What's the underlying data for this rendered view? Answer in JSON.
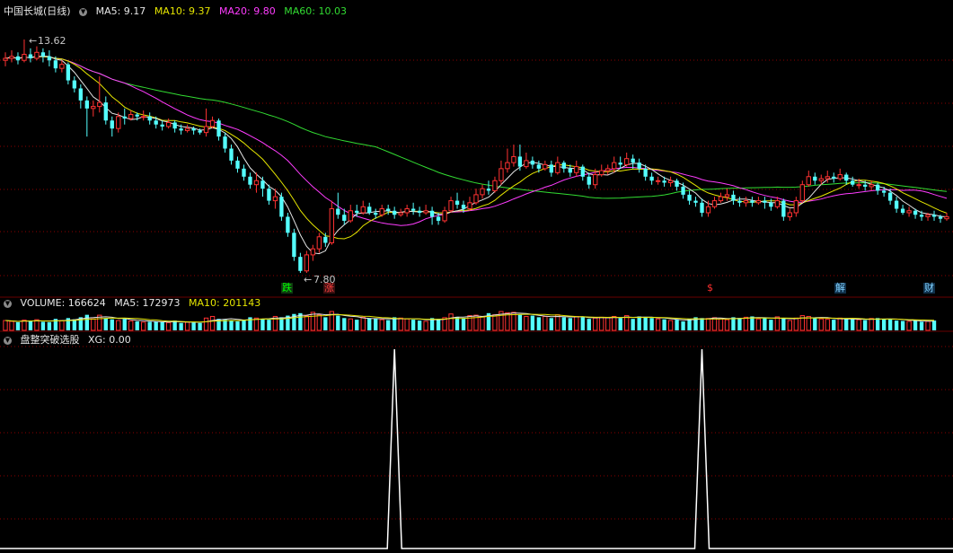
{
  "price_panel": {
    "title": "中国长城(日线)",
    "ma5": "MA5: 9.17",
    "ma10": "MA10: 9.37",
    "ma20": "MA20: 9.80",
    "ma60": "MA60: 10.03",
    "high_label": "13.62",
    "low_label": "7.80",
    "events": [
      {
        "label": "跌",
        "color": "#00ff00",
        "bg": "#103810"
      },
      {
        "label": "涨",
        "color": "#ff4040",
        "bg": "#3a1010"
      },
      {
        "label": "$",
        "color": "#ff3030",
        "bg": ""
      },
      {
        "label": "解",
        "color": "#7fd0ff",
        "bg": "#10304a"
      },
      {
        "label": "财",
        "color": "#7fd0ff",
        "bg": "#10304a"
      }
    ]
  },
  "volume_panel": {
    "volume": "VOLUME: 166624",
    "ma5": "MA5: 172973",
    "ma10": "MA10: 201143"
  },
  "indicator_panel": {
    "name": "盘整突破选股",
    "xg": "XG: 0.00"
  },
  "colors": {
    "up": "#ff3232",
    "down": "#54ffff",
    "ma5": "#e6e6e6",
    "ma10": "#e6e600",
    "ma20": "#ff3cff",
    "ma60": "#32dc32",
    "grid": "#8b0000"
  },
  "chart_data": {
    "type": "candlestick",
    "price_scale": [
      7.8,
      13.62
    ],
    "candles": [
      [
        13.1,
        13.15,
        13.3,
        12.95
      ],
      [
        13.15,
        13.2,
        13.35,
        13.05
      ],
      [
        13.2,
        13.1,
        13.3,
        13.0
      ],
      [
        13.1,
        13.25,
        13.62,
        13.05
      ],
      [
        13.25,
        13.15,
        13.4,
        13.05
      ],
      [
        13.15,
        13.3,
        13.45,
        13.1
      ],
      [
        13.3,
        13.2,
        13.4,
        13.05
      ],
      [
        13.2,
        13.1,
        13.35,
        12.95
      ],
      [
        13.1,
        12.9,
        13.2,
        12.8
      ],
      [
        12.9,
        13.0,
        13.1,
        12.8
      ],
      [
        13.0,
        12.6,
        13.05,
        12.5
      ],
      [
        12.6,
        12.4,
        12.7,
        12.3
      ],
      [
        12.4,
        12.1,
        12.5,
        11.9
      ],
      [
        12.1,
        11.9,
        12.2,
        11.2
      ],
      [
        11.9,
        11.95,
        12.1,
        11.7
      ],
      [
        11.95,
        12.05,
        12.7,
        11.8
      ],
      [
        12.05,
        11.6,
        12.2,
        11.5
      ],
      [
        11.6,
        11.4,
        11.7,
        11.2
      ],
      [
        11.4,
        11.7,
        11.8,
        11.3
      ],
      [
        11.7,
        11.65,
        11.9,
        11.5
      ],
      [
        11.65,
        11.75,
        11.85,
        11.6
      ],
      [
        11.75,
        11.7,
        11.8,
        11.6
      ],
      [
        11.7,
        11.7,
        11.85,
        11.6
      ],
      [
        11.7,
        11.6,
        11.8,
        11.5
      ],
      [
        11.6,
        11.5,
        11.7,
        11.4
      ],
      [
        11.5,
        11.45,
        11.6,
        11.35
      ],
      [
        11.45,
        11.55,
        11.65,
        11.4
      ],
      [
        11.55,
        11.4,
        11.6,
        11.3
      ],
      [
        11.4,
        11.35,
        11.5,
        11.25
      ],
      [
        11.35,
        11.4,
        11.5,
        11.3
      ],
      [
        11.4,
        11.35,
        11.45,
        11.25
      ],
      [
        11.35,
        11.3,
        11.4,
        11.25
      ],
      [
        11.3,
        11.45,
        11.9,
        11.2
      ],
      [
        11.45,
        11.6,
        11.7,
        11.4
      ],
      [
        11.6,
        11.2,
        11.65,
        11.1
      ],
      [
        11.2,
        10.9,
        11.3,
        10.8
      ],
      [
        10.9,
        10.6,
        11.0,
        10.5
      ],
      [
        10.6,
        10.4,
        10.7,
        10.3
      ],
      [
        10.4,
        10.2,
        10.5,
        10.1
      ],
      [
        10.2,
        10.0,
        10.3,
        9.9
      ],
      [
        10.0,
        10.1,
        10.3,
        9.8
      ],
      [
        10.1,
        9.9,
        10.2,
        9.7
      ],
      [
        9.9,
        9.6,
        10.0,
        9.5
      ],
      [
        9.6,
        9.7,
        9.9,
        9.4
      ],
      [
        9.7,
        9.2,
        9.8,
        9.1
      ],
      [
        9.2,
        8.8,
        9.3,
        8.7
      ],
      [
        8.8,
        8.2,
        8.9,
        8.1
      ],
      [
        8.2,
        7.85,
        8.3,
        7.8
      ],
      [
        7.85,
        8.25,
        8.35,
        7.8
      ],
      [
        8.25,
        8.4,
        8.5,
        8.1
      ],
      [
        8.4,
        8.7,
        8.8,
        8.3
      ],
      [
        8.7,
        8.55,
        8.8,
        8.45
      ],
      [
        8.55,
        9.4,
        9.6,
        8.5
      ],
      [
        9.4,
        9.25,
        9.8,
        9.15
      ],
      [
        9.25,
        9.1,
        9.4,
        9.0
      ],
      [
        9.1,
        9.35,
        9.5,
        9.05
      ],
      [
        9.35,
        9.3,
        9.5,
        9.2
      ],
      [
        9.3,
        9.45,
        9.6,
        9.25
      ],
      [
        9.45,
        9.3,
        9.55,
        9.25
      ],
      [
        9.3,
        9.25,
        9.4,
        9.15
      ],
      [
        9.25,
        9.4,
        9.5,
        9.2
      ],
      [
        9.4,
        9.35,
        9.5,
        9.25
      ],
      [
        9.35,
        9.25,
        9.45,
        9.15
      ],
      [
        9.25,
        9.3,
        9.4,
        9.2
      ],
      [
        9.3,
        9.4,
        9.5,
        9.2
      ],
      [
        9.4,
        9.35,
        9.55,
        9.25
      ],
      [
        9.35,
        9.3,
        9.45,
        9.2
      ],
      [
        9.3,
        9.35,
        9.5,
        9.25
      ],
      [
        9.35,
        9.2,
        9.45,
        9.0
      ],
      [
        9.2,
        9.1,
        9.3,
        9.0
      ],
      [
        9.1,
        9.35,
        9.45,
        9.05
      ],
      [
        9.35,
        9.6,
        9.7,
        9.3
      ],
      [
        9.6,
        9.5,
        9.8,
        9.4
      ],
      [
        9.5,
        9.4,
        9.6,
        9.3
      ],
      [
        9.4,
        9.55,
        9.7,
        9.35
      ],
      [
        9.55,
        9.75,
        9.9,
        9.5
      ],
      [
        9.75,
        9.9,
        10.0,
        9.65
      ],
      [
        9.9,
        9.85,
        10.1,
        9.75
      ],
      [
        9.85,
        10.1,
        10.2,
        9.8
      ],
      [
        10.1,
        10.4,
        10.6,
        10.0
      ],
      [
        10.4,
        10.55,
        10.9,
        10.3
      ],
      [
        10.55,
        10.7,
        11.0,
        10.45
      ],
      [
        10.7,
        10.45,
        11.0,
        10.35
      ],
      [
        10.45,
        10.6,
        10.8,
        10.4
      ],
      [
        10.6,
        10.5,
        10.7,
        10.4
      ],
      [
        10.5,
        10.4,
        10.6,
        10.3
      ],
      [
        10.4,
        10.5,
        10.6,
        10.35
      ],
      [
        10.5,
        10.3,
        10.6,
        10.2
      ],
      [
        10.3,
        10.55,
        10.7,
        10.25
      ],
      [
        10.55,
        10.4,
        10.6,
        10.3
      ],
      [
        10.4,
        10.3,
        10.5,
        10.2
      ],
      [
        10.3,
        10.45,
        10.6,
        10.2
      ],
      [
        10.45,
        10.2,
        10.5,
        10.1
      ],
      [
        10.2,
        10.0,
        10.3,
        9.9
      ],
      [
        10.0,
        10.25,
        10.4,
        9.9
      ],
      [
        10.25,
        10.35,
        10.5,
        10.2
      ],
      [
        10.35,
        10.4,
        10.5,
        10.25
      ],
      [
        10.4,
        10.55,
        10.7,
        10.3
      ],
      [
        10.55,
        10.5,
        10.7,
        10.4
      ],
      [
        10.5,
        10.65,
        10.8,
        10.45
      ],
      [
        10.65,
        10.55,
        10.75,
        10.4
      ],
      [
        10.55,
        10.4,
        10.65,
        10.3
      ],
      [
        10.4,
        10.2,
        10.5,
        10.1
      ],
      [
        10.2,
        10.1,
        10.3,
        10.0
      ],
      [
        10.1,
        10.1,
        10.2,
        10.0
      ],
      [
        10.1,
        10.05,
        10.2,
        9.95
      ],
      [
        10.05,
        10.1,
        10.2,
        9.95
      ],
      [
        10.1,
        9.95,
        10.15,
        9.85
      ],
      [
        9.95,
        9.75,
        10.05,
        9.65
      ],
      [
        9.75,
        9.6,
        9.85,
        9.5
      ],
      [
        9.6,
        9.55,
        9.7,
        9.45
      ],
      [
        9.55,
        9.3,
        9.65,
        9.2
      ],
      [
        9.3,
        9.45,
        9.6,
        9.2
      ],
      [
        9.45,
        9.6,
        9.7,
        9.4
      ],
      [
        9.6,
        9.7,
        9.8,
        9.55
      ],
      [
        9.7,
        9.75,
        9.9,
        9.6
      ],
      [
        9.75,
        9.6,
        9.85,
        9.5
      ],
      [
        9.6,
        9.55,
        9.7,
        9.45
      ],
      [
        9.55,
        9.6,
        9.7,
        9.45
      ],
      [
        9.6,
        9.55,
        9.7,
        9.45
      ],
      [
        9.55,
        9.6,
        9.7,
        9.5
      ],
      [
        9.6,
        9.55,
        9.7,
        9.4
      ],
      [
        9.55,
        9.45,
        9.65,
        9.35
      ],
      [
        9.45,
        9.6,
        9.7,
        9.4
      ],
      [
        9.6,
        9.2,
        9.65,
        9.1
      ],
      [
        9.2,
        9.3,
        9.4,
        9.1
      ],
      [
        9.3,
        9.6,
        9.7,
        9.2
      ],
      [
        9.6,
        10.0,
        10.1,
        9.55
      ],
      [
        10.0,
        10.2,
        10.35,
        9.95
      ],
      [
        10.2,
        10.1,
        10.3,
        10.0
      ],
      [
        10.1,
        10.15,
        10.25,
        10.0
      ],
      [
        10.15,
        10.2,
        10.35,
        10.05
      ],
      [
        10.2,
        10.15,
        10.3,
        10.05
      ],
      [
        10.15,
        10.25,
        10.4,
        10.1
      ],
      [
        10.25,
        10.1,
        10.3,
        10.0
      ],
      [
        10.1,
        10.0,
        10.2,
        9.95
      ],
      [
        10.0,
        10.0,
        10.15,
        9.9
      ],
      [
        10.0,
        9.95,
        10.1,
        9.85
      ],
      [
        9.95,
        10.0,
        10.1,
        9.85
      ],
      [
        10.0,
        9.85,
        10.05,
        9.75
      ],
      [
        9.85,
        9.8,
        9.95,
        9.7
      ],
      [
        9.8,
        9.6,
        9.9,
        9.5
      ],
      [
        9.6,
        9.4,
        9.7,
        9.3
      ],
      [
        9.4,
        9.3,
        9.5,
        9.25
      ],
      [
        9.3,
        9.35,
        9.45,
        9.2
      ],
      [
        9.35,
        9.25,
        9.4,
        9.15
      ],
      [
        9.25,
        9.2,
        9.35,
        9.1
      ],
      [
        9.2,
        9.25,
        9.3,
        9.1
      ],
      [
        9.25,
        9.2,
        9.35,
        9.1
      ],
      [
        9.2,
        9.15,
        9.25,
        9.05
      ],
      [
        9.15,
        9.2,
        9.3,
        9.1
      ]
    ],
    "volume": [
      120,
      110,
      100,
      125,
      115,
      130,
      105,
      100,
      140,
      120,
      150,
      135,
      160,
      190,
      140,
      185,
      150,
      135,
      120,
      140,
      115,
      110,
      100,
      105,
      110,
      100,
      95,
      120,
      90,
      100,
      95,
      90,
      150,
      170,
      140,
      130,
      120,
      110,
      130,
      160,
      150,
      140,
      130,
      170,
      160,
      180,
      200,
      210,
      175,
      220,
      190,
      160,
      230,
      180,
      150,
      140,
      130,
      160,
      150,
      140,
      130,
      125,
      160,
      150,
      140,
      130,
      120,
      110,
      150,
      140,
      155,
      200,
      165,
      150,
      180,
      185,
      170,
      210,
      190,
      230,
      215,
      220,
      190,
      170,
      180,
      160,
      170,
      150,
      190,
      160,
      150,
      170,
      160,
      140,
      150,
      160,
      155,
      170,
      150,
      180,
      140,
      170,
      165,
      150,
      140,
      135,
      120,
      130,
      110,
      140,
      160,
      150,
      145,
      155,
      140,
      130,
      160,
      150,
      160,
      170,
      140,
      150,
      130,
      165,
      145,
      120,
      150,
      180,
      170,
      150,
      140,
      135,
      130,
      150,
      140,
      135,
      130,
      125,
      145,
      150,
      140,
      135,
      120,
      115,
      110,
      120,
      105,
      110,
      120
    ],
    "vol_ma5": [],
    "xg_signals": [
      62,
      111
    ]
  }
}
